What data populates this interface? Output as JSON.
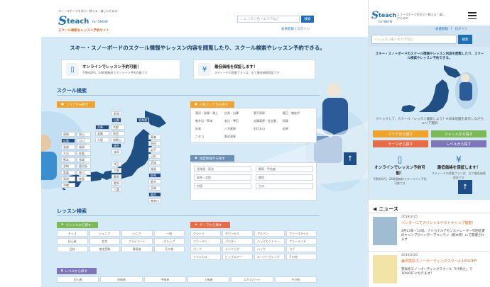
{
  "desktop": {
    "tagline": "スノースポーツを学ぶ・教える・楽しむための",
    "logo": {
      "mark": "S",
      "brand": "teach",
      "suffix": "for SNOW",
      "sub": "スクール検索＆レッスン予約サイト"
    },
    "search": {
      "placeholder": "レッスン名・エリアなど",
      "button": "検索"
    },
    "links": {
      "register": "会員登録",
      "separator": "|",
      "login": "ログイン"
    },
    "hero_title": "スキー・スノーボードのスクール情報やレッスン内容を閲覧したり、スクール検索やレッスン予約できる。",
    "features": [
      {
        "icon": "smartphone-icon",
        "title": "オンラインでレッスン予約可能！",
        "desc": "手数料0円。24時間無料でオンライン予約可能です"
      },
      {
        "icon": "yen-icon",
        "title": "最低価格を保証します！",
        "desc": "スティーチの提載プランは、全て最低価格保証です"
      }
    ],
    "school_search": {
      "title": "スクール検索",
      "area_tab": "エリアから探す",
      "popular_tab": "人気エリアから探す",
      "region_tab": "指定地域から探す",
      "prefectures_left": [
        {
          "name": "北海道",
          "dark": true
        },
        {
          "name": "青森",
          "dark": false
        },
        {
          "name": "秋田",
          "dark": false
        },
        {
          "name": "岩手",
          "dark": false
        },
        {
          "name": "山形",
          "dark": false
        },
        {
          "name": "宮城",
          "dark": false
        },
        {
          "name": "福島",
          "dark": false
        },
        {
          "name": "新潟",
          "dark": false
        },
        {
          "name": "山梨",
          "dark": true
        },
        {
          "name": "長野",
          "dark": true
        },
        {
          "name": "富山",
          "dark": false
        },
        {
          "name": "石川",
          "dark": false
        },
        {
          "name": "福井",
          "dark": true
        },
        {
          "name": "岐阜",
          "dark": false
        },
        {
          "name": "群馬",
          "dark": true
        },
        {
          "name": "栃木",
          "dark": false
        },
        {
          "name": "茨城",
          "dark": false
        },
        {
          "name": "埼玉",
          "dark": false
        },
        {
          "name": "東京",
          "dark": true
        },
        {
          "name": "千葉",
          "dark": false
        },
        {
          "name": "神奈川",
          "dark": false
        },
        {
          "name": "静岡",
          "dark": false
        },
        {
          "name": "愛知",
          "dark": false
        },
        {
          "name": "三重",
          "dark": false
        }
      ],
      "prefectures_west": [
        {
          "name": "兵庫",
          "dark": true
        },
        {
          "name": "京都",
          "dark": false
        },
        {
          "name": "滋賀",
          "dark": false
        },
        {
          "name": "奈良",
          "dark": false
        },
        {
          "name": "大阪",
          "dark": false
        },
        {
          "name": "和歌山",
          "dark": false
        },
        {
          "name": "鳥取",
          "dark": false
        },
        {
          "name": "岡山",
          "dark": false
        },
        {
          "name": "広島",
          "dark": true
        },
        {
          "name": "山口",
          "dark": false
        },
        {
          "name": "島根",
          "dark": false
        },
        {
          "name": "福岡",
          "dark": false
        },
        {
          "name": "大分",
          "dark": false
        },
        {
          "name": "佐賀",
          "dark": false
        },
        {
          "name": "熊本",
          "dark": false
        },
        {
          "name": "長崎",
          "dark": false
        },
        {
          "name": "宮崎",
          "dark": false
        },
        {
          "name": "鹿児島",
          "dark": false
        },
        {
          "name": "愛媛",
          "dark": false
        },
        {
          "name": "香川",
          "dark": false
        },
        {
          "name": "高知",
          "dark": false
        },
        {
          "name": "徳島",
          "dark": false
        },
        {
          "name": "沖縄",
          "dark": false
        }
      ],
      "popular_areas": [
        "湯沢・苗場・浦上",
        "白馬・白樺",
        "菅平高原",
        "蔵王・猪苗代",
        "軽井沢・草津",
        "安比・雫石",
        "志賀高原・北志賀",
        "斑尾",
        "妙高",
        "八方尾根",
        "石打丸山",
        "岩原",
        "ニセコ",
        "野沢温泉",
        "岩鷲",
        "会津"
      ],
      "regions": [
        "北海道・東北",
        "関東・甲信越",
        "東海・北陸",
        "関西",
        "中国",
        "九州"
      ]
    },
    "lesson_search": {
      "title": "レッスン検索",
      "genre_tab": "ジャンルから探す",
      "theme_tab": "テーマから探す",
      "level_tab": "レベルから探す",
      "genres": [
        "キッズ",
        "ジュニア",
        "シニア",
        "一般",
        "初心者",
        "女性",
        "プライベート",
        "グループ",
        "団体",
        "検定受験",
        "障害者",
        "その他"
      ],
      "themes": [
        "グラトリ",
        "ダウンヒル",
        "アルペン",
        "フリースタイル",
        "ツリーラン",
        "パウダー",
        "バックカントリー",
        "フリーライド",
        "パーク",
        "ランニング",
        "ハイク",
        "コブ",
        "テクニカル",
        "ビッグエアー",
        "スーパーグレンデ",
        "その他"
      ],
      "levels": [
        "初心者",
        "初級者",
        "中級者",
        "上級者",
        "エキスパート",
        "その他"
      ]
    },
    "back_to_top": "↑"
  },
  "mobile": {
    "tagline": "スノースポーツを学ぶ・教える・楽しむための",
    "logo": {
      "mark": "S",
      "brand": "teach",
      "suffix": "for SNOW"
    },
    "links": {
      "register": "会員登録",
      "login": "ログイン"
    },
    "search": {
      "placeholder": "レッスン名・エリアなど",
      "button": "検索"
    },
    "hero_title": "スキー・スノーボードのスクール情報やレッスン内容を閲覧したり、スクール検索やレッスン予約できる。",
    "tap_text": "クリックして、スクール・レッスン検索しよう！※日本地図を表示しながらエリア選択",
    "buttons": [
      {
        "label": "エリアから探す",
        "color": "#f0a32a"
      },
      {
        "label": "ジャンルから探す",
        "color": "#7ab955"
      },
      {
        "label": "テーマから探す",
        "color": "#e96b46"
      },
      {
        "label": "レベルから探す",
        "color": "#7f76b8"
      }
    ],
    "features": [
      {
        "title": "オンラインでレッスン予約可能！",
        "desc": "手数料0円。24時間無料でオンライン予約可能です"
      },
      {
        "title": "最低価格を保証します！",
        "desc": "スティーチの提載プランは、全て最低価格保証です"
      }
    ],
    "news_title": "ニュース",
    "news": [
      {
        "date": "2019/2/25",
        "headline": "ハンターにてスペシャルゲストキャンプ開催！",
        "body": "4月13日・14日、ナショナルデモンストレーター竹田征憲のキャンプがハンターマウンテン（栃木県）にて開催されます"
      },
      {
        "date": "2019/2/20",
        "headline": "鹿沢高原スノーボーディングスクール10%OFF！",
        "body": "菅高原スノーボーディングスクール「HP見た」で10%OFFになります！"
      }
    ],
    "back_to_top": "↑",
    "menu_icon": "hamburger-icon"
  }
}
